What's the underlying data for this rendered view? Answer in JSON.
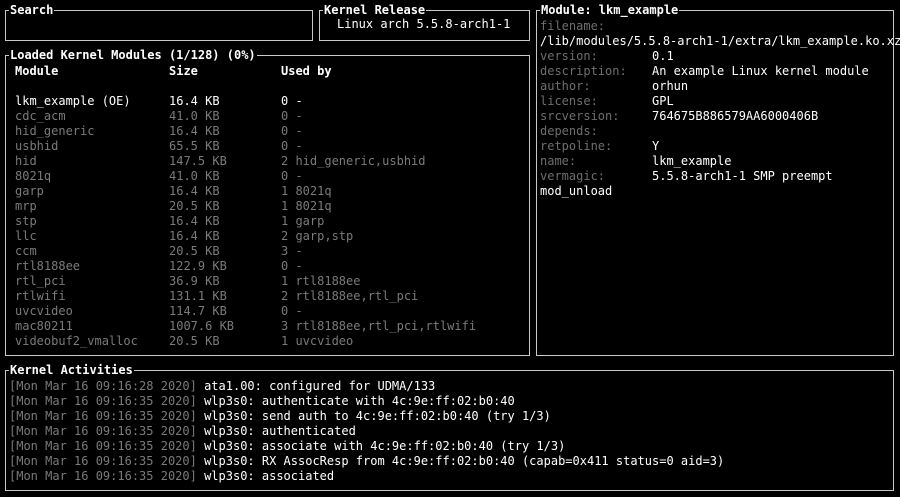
{
  "search": {
    "title": "Search",
    "value": ""
  },
  "release": {
    "title": "Kernel Release",
    "text": "Linux arch 5.5.8-arch1-1"
  },
  "modules": {
    "title": "Loaded Kernel Modules (1/128) (0%)",
    "headers": {
      "name": "Module",
      "size": "Size",
      "used_by": "Used by"
    },
    "rows": [
      {
        "name": "lkm_example (OE)",
        "size": "16.4 KB",
        "used_by": "0 -"
      },
      {
        "name": "cdc_acm",
        "size": "41.0 KB",
        "used_by": "0 -"
      },
      {
        "name": "hid_generic",
        "size": "16.4 KB",
        "used_by": "0 -"
      },
      {
        "name": "usbhid",
        "size": "65.5 KB",
        "used_by": "0 -"
      },
      {
        "name": "hid",
        "size": "147.5 KB",
        "used_by": "2 hid_generic,usbhid"
      },
      {
        "name": "8021q",
        "size": "41.0 KB",
        "used_by": "0 -"
      },
      {
        "name": "garp",
        "size": "16.4 KB",
        "used_by": "1 8021q"
      },
      {
        "name": "mrp",
        "size": "20.5 KB",
        "used_by": "1 8021q"
      },
      {
        "name": "stp",
        "size": "16.4 KB",
        "used_by": "1 garp"
      },
      {
        "name": "llc",
        "size": "16.4 KB",
        "used_by": "2 garp,stp"
      },
      {
        "name": "ccm",
        "size": "20.5 KB",
        "used_by": "3 -"
      },
      {
        "name": "rtl8188ee",
        "size": "122.9 KB",
        "used_by": "0 -"
      },
      {
        "name": "rtl_pci",
        "size": "36.9 KB",
        "used_by": "1 rtl8188ee"
      },
      {
        "name": "rtlwifi",
        "size": "131.1 KB",
        "used_by": "2 rtl8188ee,rtl_pci"
      },
      {
        "name": "uvcvideo",
        "size": "114.7 KB",
        "used_by": "0 -"
      },
      {
        "name": "mac80211",
        "size": "1007.6 KB",
        "used_by": "3 rtl8188ee,rtl_pci,rtlwifi"
      },
      {
        "name": "videobuf2_vmalloc",
        "size": "20.5 KB",
        "used_by": "1 uvcvideo"
      }
    ]
  },
  "module_info": {
    "title": "Module: lkm_example",
    "filename_key": "filename:",
    "filename_value": "/lib/modules/5.5.8-arch1-1/extra/lkm_example.ko.xz",
    "fields": [
      {
        "key": "version:",
        "value": "0.1"
      },
      {
        "key": "description:",
        "value": "An example Linux kernel module"
      },
      {
        "key": "author:",
        "value": "orhun"
      },
      {
        "key": "license:",
        "value": "GPL"
      },
      {
        "key": "srcversion:",
        "value": "764675B886579AA6000406B"
      },
      {
        "key": "depends:",
        "value": ""
      },
      {
        "key": "retpoline:",
        "value": "Y"
      },
      {
        "key": "name:",
        "value": "lkm_example"
      },
      {
        "key": "vermagic:",
        "value": "5.5.8-arch1-1 SMP preempt"
      }
    ],
    "footer": "mod_unload"
  },
  "activities": {
    "title": "Kernel Activities",
    "entries": [
      {
        "time": "[Mon Mar 16 09:16:28 2020]",
        "msg": "ata1.00: configured for UDMA/133"
      },
      {
        "time": "[Mon Mar 16 09:16:35 2020]",
        "msg": "wlp3s0: authenticate with 4c:9e:ff:02:b0:40"
      },
      {
        "time": "[Mon Mar 16 09:16:35 2020]",
        "msg": "wlp3s0: send auth to 4c:9e:ff:02:b0:40 (try 1/3)"
      },
      {
        "time": "[Mon Mar 16 09:16:35 2020]",
        "msg": "wlp3s0: authenticated"
      },
      {
        "time": "[Mon Mar 16 09:16:35 2020]",
        "msg": "wlp3s0: associate with 4c:9e:ff:02:b0:40 (try 1/3)"
      },
      {
        "time": "[Mon Mar 16 09:16:35 2020]",
        "msg": "wlp3s0: RX AssocResp from 4c:9e:ff:02:b0:40 (capab=0x411 status=0 aid=3)"
      },
      {
        "time": "[Mon Mar 16 09:16:35 2020]",
        "msg": "wlp3s0: associated"
      }
    ]
  },
  "colors": {
    "background": "#000000",
    "border": "#c8c8c8",
    "text_bright": "#ffffff",
    "text_dim": "#7a7a7a"
  }
}
